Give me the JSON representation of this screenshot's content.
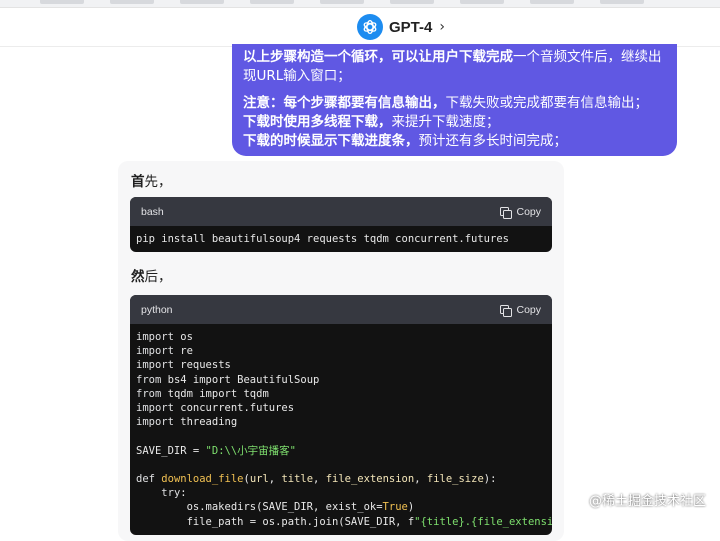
{
  "header": {
    "model_name": "GPT-4",
    "chevron": "›",
    "logo_icon": "openai-logo-icon"
  },
  "user_message": {
    "line1_bold": "以上步骤构造一个循环，可以让用户下载完成",
    "line1_rest": "一个音频文件后，继续出现URL输入窗口；",
    "line2_bold": "注意：每个步骤都要有信息输出，",
    "line2_rest": "下载失败或完成都要有信息输出；",
    "line3_bold": "下载时使用多线程下载，",
    "line3_rest": "来提升下载速度；",
    "line4_bold": "下载的时候显示下载进度条，",
    "line4_rest": "预计还有多长时间完成；"
  },
  "assistant": {
    "intro_bold": "首",
    "intro_rest": "先，",
    "then_bold": "然",
    "then_rest": "后，",
    "code1": {
      "language": "bash",
      "copy_label": "Copy",
      "line": "pip install beautifulsoup4 requests tqdm concurrent.futures"
    },
    "code2": {
      "language": "python",
      "copy_label": "Copy",
      "lines": [
        "import os",
        "import re",
        "import requests",
        "from bs4 import BeautifulSoup",
        "from tqdm import tqdm",
        "import concurrent.futures",
        "import threading",
        "",
        "SAVE_DIR = \"D:\\\\小宇宙播客\"",
        "",
        "def download_file(url, title, file_extension, file_size):",
        "    try:",
        "        os.makedirs(SAVE_DIR, exist_ok=True)",
        "        file_path = os.path.join(SAVE_DIR, f\"{title}.{file_extension}\")"
      ]
    }
  },
  "watermark": "@稀土掘金技术社区",
  "colors": {
    "user_bubble": "#6058e3",
    "code_header": "#363840",
    "code_bg": "#121212"
  }
}
